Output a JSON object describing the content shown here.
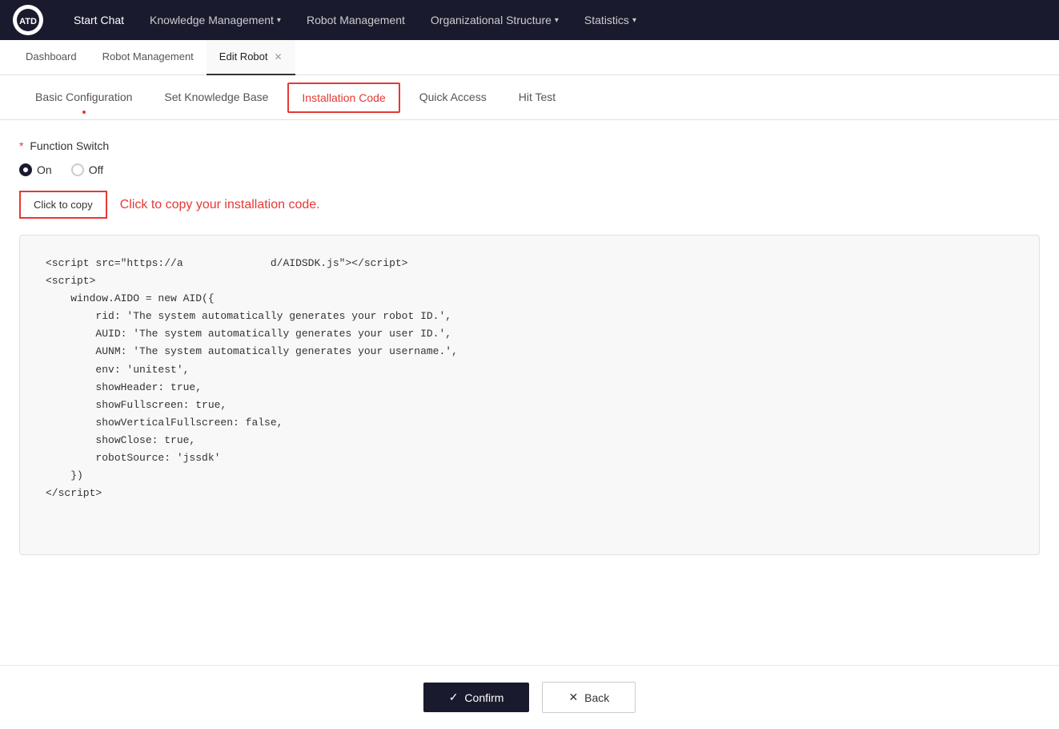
{
  "brand": {
    "logo_text": "ATD"
  },
  "nav": {
    "items": [
      {
        "id": "start-chat",
        "label": "Start Chat",
        "has_chevron": false
      },
      {
        "id": "knowledge-management",
        "label": "Knowledge Management",
        "has_chevron": true
      },
      {
        "id": "robot-management",
        "label": "Robot Management",
        "has_chevron": false
      },
      {
        "id": "organizational-structure",
        "label": "Organizational Structure",
        "has_chevron": true
      },
      {
        "id": "statistics",
        "label": "Statistics",
        "has_chevron": true
      }
    ]
  },
  "breadcrumbs": [
    {
      "id": "dashboard",
      "label": "Dashboard",
      "active": false,
      "closeable": false
    },
    {
      "id": "robot-management",
      "label": "Robot Management",
      "active": false,
      "closeable": false
    },
    {
      "id": "edit-robot",
      "label": "Edit Robot",
      "active": true,
      "closeable": true
    }
  ],
  "sub_tabs": [
    {
      "id": "basic-configuration",
      "label": "Basic Configuration",
      "active": false,
      "has_dot": true
    },
    {
      "id": "set-knowledge-base",
      "label": "Set Knowledge Base",
      "active": false,
      "has_dot": false
    },
    {
      "id": "installation-code",
      "label": "Installation Code",
      "active": true,
      "has_dot": false
    },
    {
      "id": "quick-access",
      "label": "Quick Access",
      "active": false,
      "has_dot": false
    },
    {
      "id": "hit-test",
      "label": "Hit Test",
      "active": false,
      "has_dot": false
    }
  ],
  "function_switch": {
    "label": "Function Switch",
    "required": true,
    "options": [
      {
        "id": "on",
        "label": "On",
        "checked": true
      },
      {
        "id": "off",
        "label": "Off",
        "checked": false
      }
    ]
  },
  "copy_area": {
    "button_label": "Click to copy",
    "hint_text": "Click to copy your installation code."
  },
  "code_content": {
    "line1": "<script src=\"https://a",
    "line1_blurred": "              ",
    "line1_end": "d/AIDSDK.js\"></script>",
    "line2": "<script>",
    "line3": "    window.AIDO = new AID({",
    "line4": "        rid: 'The system automatically generates your robot ID.',",
    "line5": "        AUID: 'The system automatically generates your user ID.',",
    "line6": "        AUNM: 'The system automatically generates your username.',",
    "line7": "        env: 'unitest',",
    "line8": "        showHeader: true,",
    "line9": "        showFullscreen: true,",
    "line10": "        showVerticalFullscreen: false,",
    "line11": "        showClose: true,",
    "line12": "        robotSource: 'jssdk'",
    "line13": "    })",
    "line14": "</script>"
  },
  "footer": {
    "confirm_label": "Confirm",
    "back_label": "Back"
  },
  "colors": {
    "accent": "#e53935",
    "nav_bg": "#1a1a2e"
  }
}
